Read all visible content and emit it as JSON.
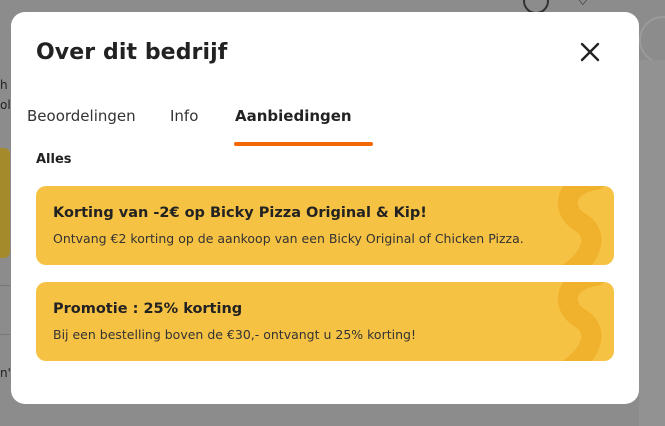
{
  "modal": {
    "title": "Over dit bedrijf",
    "close_label": "Sluiten"
  },
  "tabs": [
    {
      "label": "Beoordelingen",
      "active": false
    },
    {
      "label": "Info",
      "active": false
    },
    {
      "label": "Aanbiedingen",
      "active": true
    }
  ],
  "filter": {
    "label": "Alles"
  },
  "offers": [
    {
      "title": "Korting van -2€ op Bicky Pizza Original & Kip!",
      "description": "Ontvang €2 korting op de aankoop van een Bicky Original of Chicken Pizza."
    },
    {
      "title": "Promotie : 25% korting",
      "description": "Bij een bestelling boven de €30,- ontvangt u 25% korting!"
    }
  ],
  "background": {
    "fragments": [
      "h",
      "ol",
      "n's"
    ]
  },
  "colors": {
    "accent": "#f36805",
    "offer_background": "#f6c244",
    "overlay": "#8c8c8c"
  },
  "icons": [
    "info-icon",
    "heart-icon",
    "close-icon",
    "squiggle-decoration"
  ]
}
